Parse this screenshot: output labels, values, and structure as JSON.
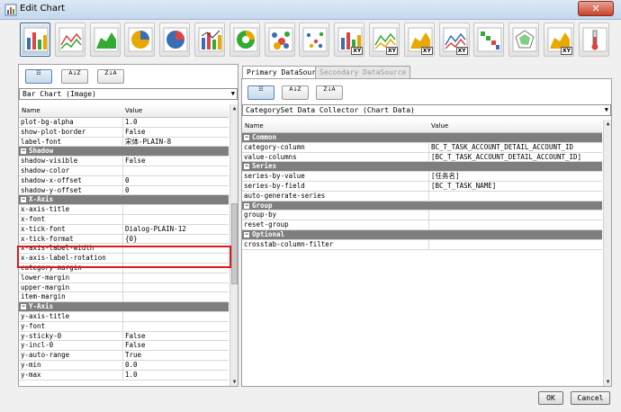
{
  "window": {
    "title": "Edit Chart",
    "close_label": "✕"
  },
  "toolbar": {
    "chart_types": [
      {
        "name": "bar-chart-icon",
        "xy": ""
      },
      {
        "name": "line-chart-icon",
        "xy": ""
      },
      {
        "name": "area-chart-icon",
        "xy": ""
      },
      {
        "name": "pie-chart-icon",
        "xy": ""
      },
      {
        "name": "multi-pie-chart-icon",
        "xy": ""
      },
      {
        "name": "bar-line-chart-icon",
        "xy": ""
      },
      {
        "name": "ring-chart-icon",
        "xy": ""
      },
      {
        "name": "bubble-chart-icon",
        "xy": ""
      },
      {
        "name": "scatter-chart-icon",
        "xy": ""
      },
      {
        "name": "xy-bar-chart-icon",
        "xy": "XY"
      },
      {
        "name": "xy-line-chart-icon",
        "xy": "XY"
      },
      {
        "name": "xy-area-chart-icon",
        "xy": "XY"
      },
      {
        "name": "xy-step-chart-icon",
        "xy": "XY"
      },
      {
        "name": "waterfall-chart-icon",
        "xy": ""
      },
      {
        "name": "radar-chart-icon",
        "xy": ""
      },
      {
        "name": "xy-area-alt-chart-icon",
        "xy": "XY"
      },
      {
        "name": "thermometer-chart-icon",
        "xy": ""
      }
    ]
  },
  "left_panel": {
    "sort_buttons": [
      "☷",
      "A↓Z",
      "Z↓A"
    ],
    "selector": "Bar Chart (Image)",
    "columns": {
      "name": "Name",
      "value": "Value"
    },
    "rows": [
      {
        "type": "prop",
        "name": "plot-bg-alpha",
        "value": "1.0"
      },
      {
        "type": "prop",
        "name": "show-plot-border",
        "value": "False"
      },
      {
        "type": "prop",
        "name": "label-font",
        "value": "宋体-PLAIN-8"
      },
      {
        "type": "cat",
        "name": "Shadow",
        "value": ""
      },
      {
        "type": "prop",
        "name": "shadow-visible",
        "value": "False"
      },
      {
        "type": "prop",
        "name": "shadow-color",
        "value": ""
      },
      {
        "type": "prop",
        "name": "shadow-x-offset",
        "value": "0"
      },
      {
        "type": "prop",
        "name": "shadow-y-offset",
        "value": "0"
      },
      {
        "type": "cat",
        "name": "X-Axis",
        "value": ""
      },
      {
        "type": "prop",
        "name": "x-axis-title",
        "value": ""
      },
      {
        "type": "prop",
        "name": "x-font",
        "value": ""
      },
      {
        "type": "prop",
        "name": "x-tick-font",
        "value": "Dialog-PLAIN-12"
      },
      {
        "type": "prop",
        "name": "x-tick-format",
        "value": "{0}"
      },
      {
        "type": "prop",
        "name": "x-axis-label-width",
        "value": ""
      },
      {
        "type": "prop",
        "name": "x-axis-label-rotation",
        "value": ""
      },
      {
        "type": "prop",
        "name": "category-margin",
        "value": ""
      },
      {
        "type": "prop",
        "name": "lower-margin",
        "value": ""
      },
      {
        "type": "prop",
        "name": "upper-margin",
        "value": ""
      },
      {
        "type": "prop",
        "name": "item-margin",
        "value": ""
      },
      {
        "type": "cat",
        "name": "Y-Axis",
        "value": ""
      },
      {
        "type": "prop",
        "name": "y-axis-title",
        "value": ""
      },
      {
        "type": "prop",
        "name": "y-font",
        "value": ""
      },
      {
        "type": "prop",
        "name": "y-sticky-0",
        "value": "False"
      },
      {
        "type": "prop",
        "name": "y-incl-0",
        "value": "False"
      },
      {
        "type": "prop",
        "name": "y-auto-range",
        "value": "True"
      },
      {
        "type": "prop",
        "name": "y-min",
        "value": "0.0"
      },
      {
        "type": "prop",
        "name": "y-max",
        "value": "1.0"
      }
    ]
  },
  "right_panel": {
    "tabs": [
      "Primary DataSource",
      "Secondary DataSource"
    ],
    "sort_buttons": [
      "☷",
      "A↓Z",
      "Z↓A"
    ],
    "selector": "CategorySet Data Collector (Chart Data)",
    "columns": {
      "name": "Name",
      "value": "Value"
    },
    "rows": [
      {
        "type": "cat",
        "name": "Common",
        "value": ""
      },
      {
        "type": "prop",
        "name": "category-column",
        "value": "BC_T_TASK_ACCOUNT_DETAIL_ACCOUNT_ID"
      },
      {
        "type": "prop",
        "name": "value-columns",
        "value": "[BC_T_TASK_ACCOUNT_DETAIL_ACCOUNT_ID]"
      },
      {
        "type": "cat",
        "name": "Series",
        "value": ""
      },
      {
        "type": "prop",
        "name": "series-by-value",
        "value": "[任务名]"
      },
      {
        "type": "prop",
        "name": "series-by-field",
        "value": "[BC_T_TASK_NAME]"
      },
      {
        "type": "prop",
        "name": "auto-generate-series",
        "value": ""
      },
      {
        "type": "cat",
        "name": "Group",
        "value": ""
      },
      {
        "type": "prop",
        "name": "group-by",
        "value": ""
      },
      {
        "type": "prop",
        "name": "reset-group",
        "value": ""
      },
      {
        "type": "cat",
        "name": "Optional",
        "value": ""
      },
      {
        "type": "prop",
        "name": "crosstab-column-filter",
        "value": ""
      }
    ]
  },
  "footer": {
    "ok_label": "OK",
    "cancel_label": "Cancel"
  },
  "colors": {
    "highlight": "#e0171c",
    "category_bg": "#7e7e7e"
  }
}
